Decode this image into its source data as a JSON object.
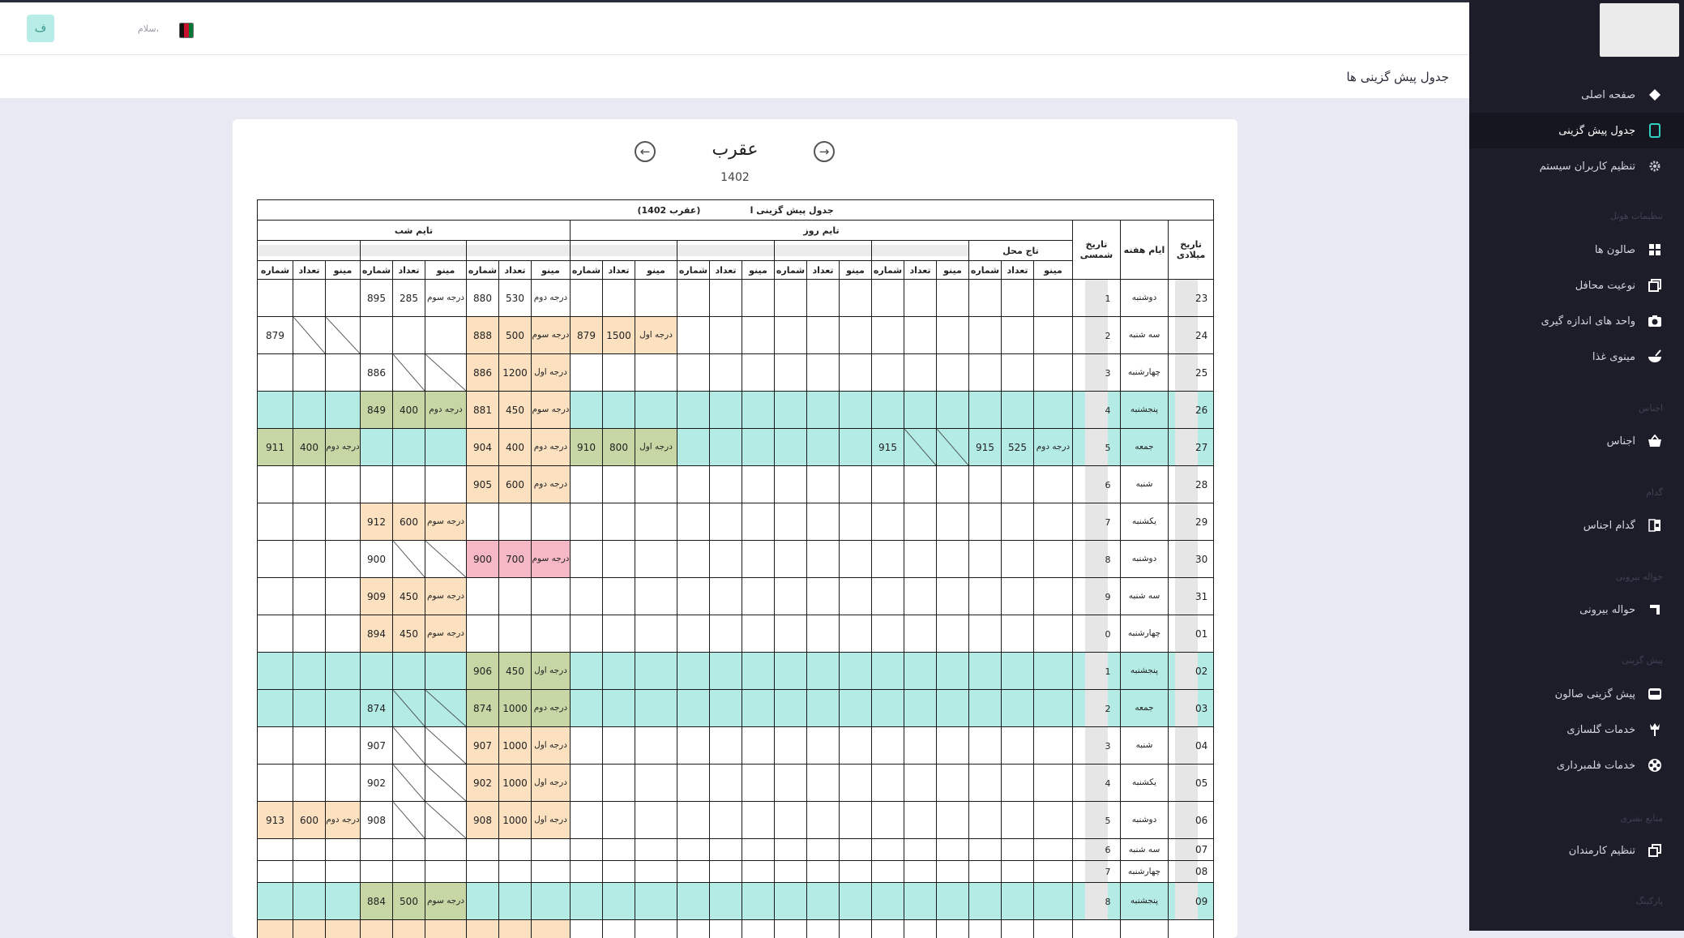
{
  "header": {
    "avatar_letter": "ف",
    "greeting": "سلام،"
  },
  "page_title": "جدول پیش گزینی ها",
  "sidebar": {
    "items": [
      {
        "label": "صفحه اصلی",
        "icon": "diamond-icon"
      },
      {
        "label": "جدول پیش گزینی",
        "icon": "tablet-icon",
        "active": true
      },
      {
        "label": "تنظیم کاربران سیستم",
        "icon": "gear-icon"
      },
      {
        "label": "صالون ها",
        "icon": "grid-icon"
      },
      {
        "label": "نوعیت محافل",
        "icon": "layers-icon"
      },
      {
        "label": "واحد های اندازه گیری",
        "icon": "camera-icon"
      },
      {
        "label": "مینوی غذا",
        "icon": "bowl-icon"
      },
      {
        "label": "اجناس",
        "icon": "basket-icon"
      },
      {
        "label": "گدام اجناس",
        "icon": "warehouse-icon"
      },
      {
        "label": "حواله بیرونی",
        "icon": "corner-icon"
      },
      {
        "label": "پیش گزینی صالون",
        "icon": "hall-icon"
      },
      {
        "label": "خدمات گلسازی",
        "icon": "flower-icon"
      },
      {
        "label": "خدمات فلمبرداری",
        "icon": "film-icon"
      },
      {
        "label": "تنظیم کارمندان",
        "icon": "copy-icon"
      }
    ],
    "sections": [
      "تنظیمات هوتل",
      "اجناس",
      "گدام",
      "حواله بیرونی",
      "پیش گزینی",
      "منابع بشری",
      "پارکینگ"
    ]
  },
  "calendar": {
    "month": "عقرب",
    "year": "1402"
  },
  "table": {
    "title": "جدول پیش گزینی ا",
    "title_month": "(عقرب 1402)",
    "col_gregorian": "تاریخ میلادی",
    "col_weekday": "ایام هفته",
    "col_shamsi": "تاریخ شمسی",
    "day_time": "تایم روز",
    "night_time": "تایم شب",
    "hall_name": "تاج محل",
    "sub_menu": "مینو",
    "sub_count": "تعداد",
    "sub_number": "شماره",
    "colors": {
      "orange": "#fbe1c0",
      "green": "#c7d6a5",
      "red": "#f6b8c4",
      "cyan": "#b4ebe5"
    },
    "rows": [
      {
        "g": "23",
        "w": "دوشنبه",
        "s": "1"
      },
      {
        "g": "24",
        "w": "سه شنبه",
        "s": "2"
      },
      {
        "g": "25",
        "w": "چهارشنبه",
        "s": "3"
      },
      {
        "g": "26",
        "w": "پنجشنبه",
        "s": "4"
      },
      {
        "g": "27",
        "w": "جمعه",
        "s": "5"
      },
      {
        "g": "28",
        "w": "شنبه",
        "s": "6"
      },
      {
        "g": "29",
        "w": "یکشنبه",
        "s": "7"
      },
      {
        "g": "30",
        "w": "دوشنبه",
        "s": "8"
      },
      {
        "g": "31",
        "w": "سه شنبه",
        "s": "9"
      },
      {
        "g": "01",
        "w": "چهارشنبه",
        "s": "0"
      },
      {
        "g": "02",
        "w": "پنجشنبه",
        "s": "1"
      },
      {
        "g": "03",
        "w": "جمعه",
        "s": "2"
      },
      {
        "g": "04",
        "w": "شنبه",
        "s": "3"
      },
      {
        "g": "05",
        "w": "یکشنبه",
        "s": "4"
      },
      {
        "g": "06",
        "w": "دوشنبه",
        "s": "5"
      },
      {
        "g": "07",
        "w": "سه شنبه",
        "s": "6"
      },
      {
        "g": "08",
        "w": "چهارشنبه",
        "s": "7"
      },
      {
        "g": "09",
        "w": "پنجشنبه",
        "s": "8"
      }
    ],
    "cells": {
      "r0": {
        "n1": [
          "درجه دوم",
          "530",
          "880"
        ],
        "n2": [
          "درجه سوم",
          "285",
          "895"
        ]
      },
      "r1": {
        "d1": [
          "درجه اول",
          "1500",
          "879"
        ],
        "n1": [
          "درجه سوم",
          "500",
          "888"
        ],
        "n3": [
          "",
          "",
          "879"
        ]
      },
      "r2": {
        "n1": [
          "درجه اول",
          "1200",
          "886"
        ],
        "n2": [
          "",
          "",
          "886"
        ]
      },
      "r3": {
        "n1": [
          "درجه سوم",
          "450",
          "881"
        ],
        "n2": [
          "درجه دوم",
          "400",
          "849"
        ]
      },
      "r4": {
        "dh": [
          "درجه دوم",
          "525",
          "915"
        ],
        "d4": [
          "",
          "",
          "915"
        ],
        "d1": [
          "درجه اول",
          "800",
          "910"
        ],
        "n1": [
          "درجه دوم",
          "400",
          "904"
        ],
        "n3": [
          "درجه دوم",
          "400",
          "911"
        ]
      },
      "r5": {
        "n1": [
          "درجه دوم",
          "600",
          "905"
        ]
      },
      "r6": {
        "n2": [
          "درجه سوم",
          "600",
          "912"
        ]
      },
      "r7": {
        "n1": [
          "درجه سوم",
          "700",
          "900"
        ],
        "n2": [
          "",
          "",
          "900"
        ]
      },
      "r8": {
        "n2": [
          "درجه سوم",
          "450",
          "909"
        ]
      },
      "r9": {
        "n2": [
          "درجه سوم",
          "450",
          "894"
        ]
      },
      "r10": {
        "n1": [
          "درجه اول",
          "450",
          "906"
        ]
      },
      "r11": {
        "n1": [
          "درجه دوم",
          "1000",
          "874"
        ],
        "n2": [
          "",
          "",
          "874"
        ]
      },
      "r12": {
        "n1": [
          "درجه اول",
          "1000",
          "907"
        ],
        "n2": [
          "",
          "",
          "907"
        ]
      },
      "r13": {
        "n1": [
          "درجه اول",
          "1000",
          "902"
        ],
        "n2": [
          "",
          "",
          "902"
        ]
      },
      "r14": {
        "n1": [
          "درجه اول",
          "1000",
          "908"
        ],
        "n2": [
          "",
          "",
          "908"
        ],
        "n3": [
          "درجه دوم",
          "600",
          "913"
        ]
      },
      "r17": {
        "n2": [
          "درجه سوم",
          "500",
          "884"
        ]
      }
    }
  }
}
